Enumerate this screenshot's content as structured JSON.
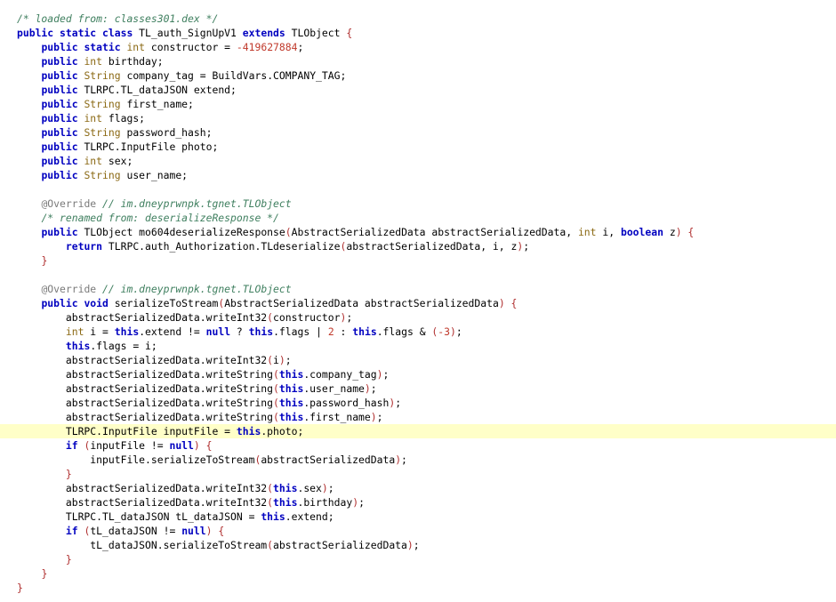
{
  "code_editor": {
    "highlighted_line": 29,
    "colors": {
      "comment": "#3f7f5f",
      "keyword": "#0000c0",
      "type": "#8b6914",
      "number": "#c0392b",
      "punct": "#b03030",
      "annotation": "#7a7a7a",
      "highlight": "#ffffc8"
    },
    "lines": [
      [
        [
          "comment",
          "/* loaded from: classes301.dex */"
        ]
      ],
      [
        [
          "keyword",
          "public static class"
        ],
        [
          "plain",
          " TL_auth_SignUpV1 "
        ],
        [
          "keyword",
          "extends"
        ],
        [
          "plain",
          " TLObject "
        ],
        [
          "punct",
          "{"
        ]
      ],
      [
        [
          "plain",
          "    "
        ],
        [
          "keyword",
          "public static"
        ],
        [
          "plain",
          " "
        ],
        [
          "type",
          "int"
        ],
        [
          "plain",
          " constructor = "
        ],
        [
          "number",
          "-419627884"
        ],
        [
          "plain",
          ";"
        ]
      ],
      [
        [
          "plain",
          "    "
        ],
        [
          "keyword",
          "public"
        ],
        [
          "plain",
          " "
        ],
        [
          "type",
          "int"
        ],
        [
          "plain",
          " birthday;"
        ]
      ],
      [
        [
          "plain",
          "    "
        ],
        [
          "keyword",
          "public"
        ],
        [
          "plain",
          " "
        ],
        [
          "type",
          "String"
        ],
        [
          "plain",
          " company_tag = BuildVars.COMPANY_TAG;"
        ]
      ],
      [
        [
          "plain",
          "    "
        ],
        [
          "keyword",
          "public"
        ],
        [
          "plain",
          " TLRPC.TL_dataJSON extend;"
        ]
      ],
      [
        [
          "plain",
          "    "
        ],
        [
          "keyword",
          "public"
        ],
        [
          "plain",
          " "
        ],
        [
          "type",
          "String"
        ],
        [
          "plain",
          " first_name;"
        ]
      ],
      [
        [
          "plain",
          "    "
        ],
        [
          "keyword",
          "public"
        ],
        [
          "plain",
          " "
        ],
        [
          "type",
          "int"
        ],
        [
          "plain",
          " flags;"
        ]
      ],
      [
        [
          "plain",
          "    "
        ],
        [
          "keyword",
          "public"
        ],
        [
          "plain",
          " "
        ],
        [
          "type",
          "String"
        ],
        [
          "plain",
          " password_hash;"
        ]
      ],
      [
        [
          "plain",
          "    "
        ],
        [
          "keyword",
          "public"
        ],
        [
          "plain",
          " TLRPC.InputFile photo;"
        ]
      ],
      [
        [
          "plain",
          "    "
        ],
        [
          "keyword",
          "public"
        ],
        [
          "plain",
          " "
        ],
        [
          "type",
          "int"
        ],
        [
          "plain",
          " sex;"
        ]
      ],
      [
        [
          "plain",
          "    "
        ],
        [
          "keyword",
          "public"
        ],
        [
          "plain",
          " "
        ],
        [
          "type",
          "String"
        ],
        [
          "plain",
          " user_name;"
        ]
      ],
      [
        [
          "plain",
          ""
        ]
      ],
      [
        [
          "plain",
          "    "
        ],
        [
          "annotation",
          "@Override"
        ],
        [
          "plain",
          " "
        ],
        [
          "comment",
          "// im.dneyprwnpk.tgnet.TLObject"
        ]
      ],
      [
        [
          "plain",
          "    "
        ],
        [
          "comment",
          "/* renamed from: deserializeResponse */"
        ]
      ],
      [
        [
          "plain",
          "    "
        ],
        [
          "keyword",
          "public"
        ],
        [
          "plain",
          " TLObject mo604deserializeResponse"
        ],
        [
          "punct",
          "("
        ],
        [
          "plain",
          "AbstractSerializedData abstractSerializedData, "
        ],
        [
          "type",
          "int"
        ],
        [
          "plain",
          " i, "
        ],
        [
          "keyword",
          "boolean"
        ],
        [
          "plain",
          " z"
        ],
        [
          "punct",
          ")"
        ],
        [
          "plain",
          " "
        ],
        [
          "punct",
          "{"
        ]
      ],
      [
        [
          "plain",
          "        "
        ],
        [
          "keyword",
          "return"
        ],
        [
          "plain",
          " TLRPC.auth_Authorization.TLdeserialize"
        ],
        [
          "punct",
          "("
        ],
        [
          "plain",
          "abstractSerializedData, i, z"
        ],
        [
          "punct",
          ")"
        ],
        [
          "plain",
          ";"
        ]
      ],
      [
        [
          "plain",
          "    "
        ],
        [
          "punct",
          "}"
        ]
      ],
      [
        [
          "plain",
          ""
        ]
      ],
      [
        [
          "plain",
          "    "
        ],
        [
          "annotation",
          "@Override"
        ],
        [
          "plain",
          " "
        ],
        [
          "comment",
          "// im.dneyprwnpk.tgnet.TLObject"
        ]
      ],
      [
        [
          "plain",
          "    "
        ],
        [
          "keyword",
          "public"
        ],
        [
          "plain",
          " "
        ],
        [
          "keyword",
          "void"
        ],
        [
          "plain",
          " serializeToStream"
        ],
        [
          "punct",
          "("
        ],
        [
          "plain",
          "AbstractSerializedData abstractSerializedData"
        ],
        [
          "punct",
          ")"
        ],
        [
          "plain",
          " "
        ],
        [
          "punct",
          "{"
        ]
      ],
      [
        [
          "plain",
          "        abstractSerializedData.writeInt32"
        ],
        [
          "punct",
          "("
        ],
        [
          "plain",
          "constructor"
        ],
        [
          "punct",
          ")"
        ],
        [
          "plain",
          ";"
        ]
      ],
      [
        [
          "plain",
          "        "
        ],
        [
          "type",
          "int"
        ],
        [
          "plain",
          " i = "
        ],
        [
          "keyword",
          "this"
        ],
        [
          "plain",
          ".extend != "
        ],
        [
          "keyword",
          "null"
        ],
        [
          "plain",
          " ? "
        ],
        [
          "keyword",
          "this"
        ],
        [
          "plain",
          ".flags | "
        ],
        [
          "number",
          "2"
        ],
        [
          "plain",
          " : "
        ],
        [
          "keyword",
          "this"
        ],
        [
          "plain",
          ".flags & "
        ],
        [
          "punct",
          "("
        ],
        [
          "number",
          "-3"
        ],
        [
          "punct",
          ")"
        ],
        [
          "plain",
          ";"
        ]
      ],
      [
        [
          "plain",
          "        "
        ],
        [
          "keyword",
          "this"
        ],
        [
          "plain",
          ".flags = i;"
        ]
      ],
      [
        [
          "plain",
          "        abstractSerializedData.writeInt32"
        ],
        [
          "punct",
          "("
        ],
        [
          "plain",
          "i"
        ],
        [
          "punct",
          ")"
        ],
        [
          "plain",
          ";"
        ]
      ],
      [
        [
          "plain",
          "        abstractSerializedData.writeString"
        ],
        [
          "punct",
          "("
        ],
        [
          "keyword",
          "this"
        ],
        [
          "plain",
          ".company_tag"
        ],
        [
          "punct",
          ")"
        ],
        [
          "plain",
          ";"
        ]
      ],
      [
        [
          "plain",
          "        abstractSerializedData.writeString"
        ],
        [
          "punct",
          "("
        ],
        [
          "keyword",
          "this"
        ],
        [
          "plain",
          ".user_name"
        ],
        [
          "punct",
          ")"
        ],
        [
          "plain",
          ";"
        ]
      ],
      [
        [
          "plain",
          "        abstractSerializedData.writeString"
        ],
        [
          "punct",
          "("
        ],
        [
          "keyword",
          "this"
        ],
        [
          "plain",
          ".password_hash"
        ],
        [
          "punct",
          ")"
        ],
        [
          "plain",
          ";"
        ]
      ],
      [
        [
          "plain",
          "        abstractSerializedData.writeString"
        ],
        [
          "punct",
          "("
        ],
        [
          "keyword",
          "this"
        ],
        [
          "plain",
          ".first_name"
        ],
        [
          "punct",
          ")"
        ],
        [
          "plain",
          ";"
        ]
      ],
      [
        [
          "plain",
          "        TLRPC.InputFile inputFile = "
        ],
        [
          "keyword",
          "this"
        ],
        [
          "plain",
          ".photo;"
        ]
      ],
      [
        [
          "plain",
          "        "
        ],
        [
          "keyword",
          "if"
        ],
        [
          "plain",
          " "
        ],
        [
          "punct",
          "("
        ],
        [
          "plain",
          "inputFile != "
        ],
        [
          "keyword",
          "null"
        ],
        [
          "punct",
          ")"
        ],
        [
          "plain",
          " "
        ],
        [
          "punct",
          "{"
        ]
      ],
      [
        [
          "plain",
          "            inputFile.serializeToStream"
        ],
        [
          "punct",
          "("
        ],
        [
          "plain",
          "abstractSerializedData"
        ],
        [
          "punct",
          ")"
        ],
        [
          "plain",
          ";"
        ]
      ],
      [
        [
          "plain",
          "        "
        ],
        [
          "punct",
          "}"
        ]
      ],
      [
        [
          "plain",
          "        abstractSerializedData.writeInt32"
        ],
        [
          "punct",
          "("
        ],
        [
          "keyword",
          "this"
        ],
        [
          "plain",
          ".sex"
        ],
        [
          "punct",
          ")"
        ],
        [
          "plain",
          ";"
        ]
      ],
      [
        [
          "plain",
          "        abstractSerializedData.writeInt32"
        ],
        [
          "punct",
          "("
        ],
        [
          "keyword",
          "this"
        ],
        [
          "plain",
          ".birthday"
        ],
        [
          "punct",
          ")"
        ],
        [
          "plain",
          ";"
        ]
      ],
      [
        [
          "plain",
          "        TLRPC.TL_dataJSON tL_dataJSON = "
        ],
        [
          "keyword",
          "this"
        ],
        [
          "plain",
          ".extend;"
        ]
      ],
      [
        [
          "plain",
          "        "
        ],
        [
          "keyword",
          "if"
        ],
        [
          "plain",
          " "
        ],
        [
          "punct",
          "("
        ],
        [
          "plain",
          "tL_dataJSON != "
        ],
        [
          "keyword",
          "null"
        ],
        [
          "punct",
          ")"
        ],
        [
          "plain",
          " "
        ],
        [
          "punct",
          "{"
        ]
      ],
      [
        [
          "plain",
          "            tL_dataJSON.serializeToStream"
        ],
        [
          "punct",
          "("
        ],
        [
          "plain",
          "abstractSerializedData"
        ],
        [
          "punct",
          ")"
        ],
        [
          "plain",
          ";"
        ]
      ],
      [
        [
          "plain",
          "        "
        ],
        [
          "punct",
          "}"
        ]
      ],
      [
        [
          "plain",
          "    "
        ],
        [
          "punct",
          "}"
        ]
      ],
      [
        [
          "punct",
          "}"
        ]
      ]
    ]
  }
}
